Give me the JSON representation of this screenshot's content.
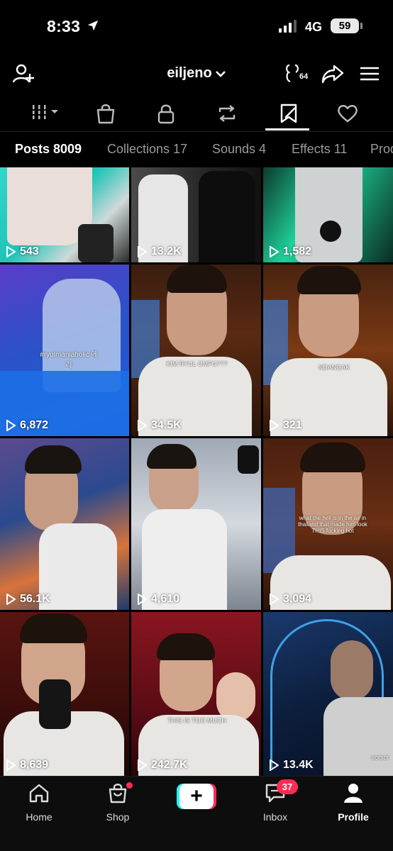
{
  "status_bar": {
    "time": "8:33",
    "network": "4G",
    "battery": "59",
    "icons": [
      "location-arrow-icon",
      "signal-icon",
      "battery-icon"
    ]
  },
  "header": {
    "username": "eiljeno",
    "ai_count": "64",
    "icons": [
      "add-friend-icon",
      "chevron-down-icon",
      "ai-self-icon",
      "share-icon",
      "menu-icon"
    ]
  },
  "content_tabs": {
    "icons": [
      "grid-filter-icon",
      "shop-bag-icon",
      "lock-icon",
      "repost-icon",
      "favorites-icon",
      "heart-icon"
    ],
    "active_index": 4
  },
  "filter_tabs": [
    {
      "label": "Posts 8009"
    },
    {
      "label": "Collections 17"
    },
    {
      "label": "Sounds 4"
    },
    {
      "label": "Effects 11"
    },
    {
      "label": "Prod"
    }
  ],
  "posts": [
    {
      "views": "543",
      "caption": ""
    },
    {
      "views": "13.2K",
      "caption": ""
    },
    {
      "views": "1,582",
      "caption": ""
    },
    {
      "views": "6,872",
      "caption": "#ryulmaniaholic 메리"
    },
    {
      "views": "34.5K",
      "caption": "KIM RYUL OMFG???"
    },
    {
      "views": "321",
      "caption": "NDANGAK"
    },
    {
      "views": "56.1K",
      "caption": ""
    },
    {
      "views": "4,610",
      "caption": ""
    },
    {
      "views": "3,094",
      "caption": "what the hell is in the air in thailand that made him look THIS fucking hot"
    },
    {
      "views": "8,639",
      "caption": ""
    },
    {
      "views": "242.7K",
      "caption": "THIS IS TOO MUCH"
    },
    {
      "views": "13.4K",
      "caption": "sorsor"
    }
  ],
  "bottom_nav": {
    "home": "Home",
    "shop": "Shop",
    "inbox": "Inbox",
    "inbox_badge": "37",
    "profile": "Profile"
  },
  "colors": {
    "accent_red": "#fe2c55",
    "accent_cyan": "#25f4ee",
    "background": "#000000"
  }
}
